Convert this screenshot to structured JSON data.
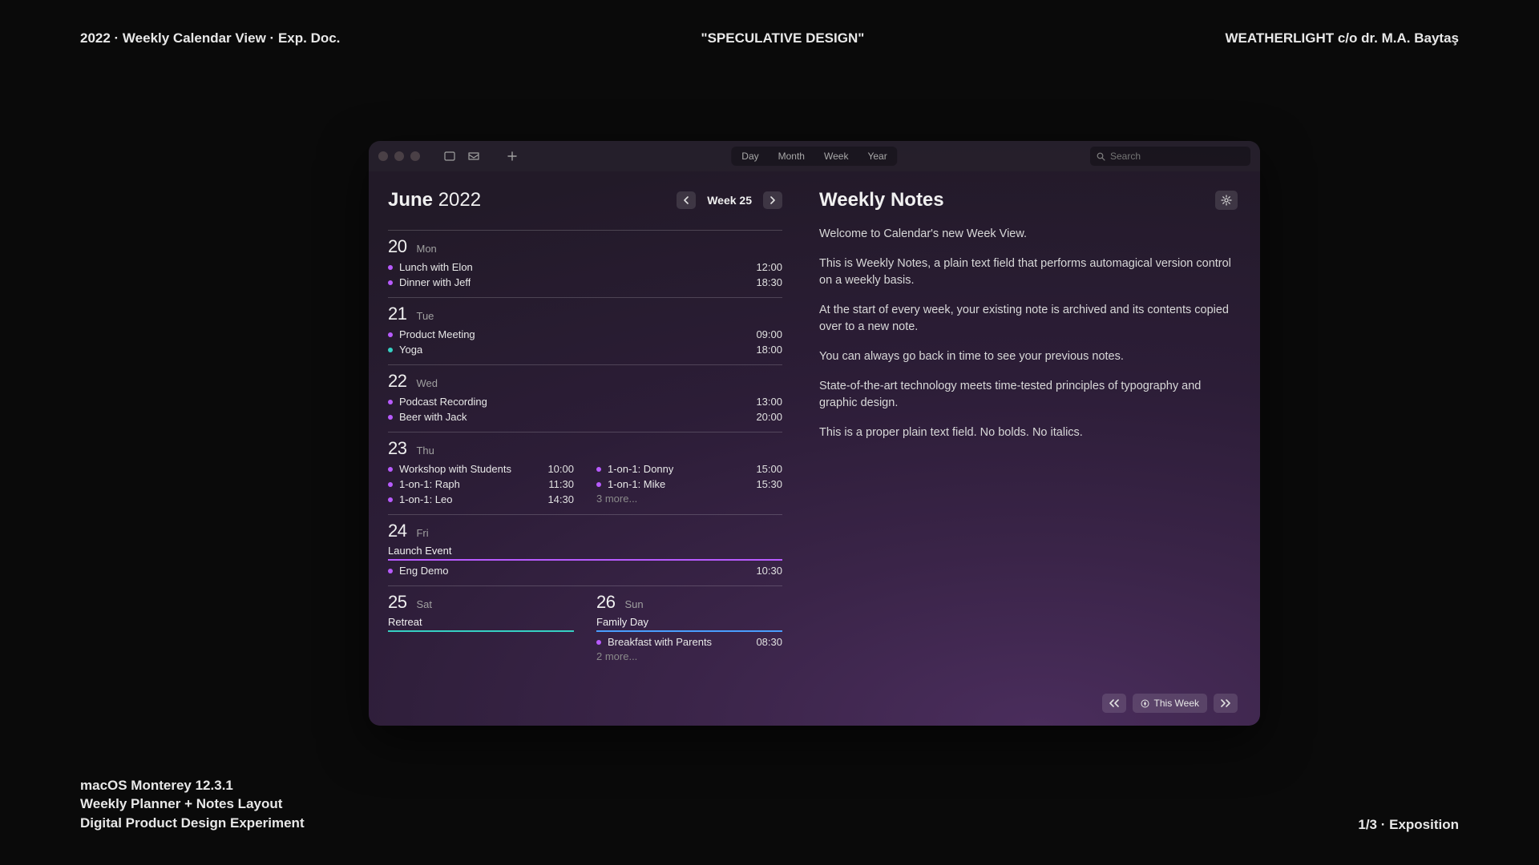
{
  "frame": {
    "header_left": "2022 · Weekly Calendar View · Exp. Doc.",
    "header_center": "\"SPECULATIVE DESIGN\"",
    "header_right": "WEATHERLIGHT c/o dr. M.A. Baytaş",
    "footer_left_1": "macOS Monterey 12.3.1",
    "footer_left_2": "Weekly Planner + Notes Layout",
    "footer_left_3": "Digital Product Design Experiment",
    "footer_right": "1/3 · Exposition"
  },
  "toolbar": {
    "view_tabs": [
      "Day",
      "Month",
      "Week",
      "Year"
    ],
    "search_placeholder": "Search"
  },
  "calendar": {
    "month_strong": "June",
    "year": "2022",
    "week_label": "Week 25",
    "colors": {
      "purple": "#b85bff",
      "teal": "#36d1c4",
      "blue": "#4a9eff"
    },
    "days": [
      {
        "num": "20",
        "dow": "Mon",
        "cols": [
          {
            "events": [
              {
                "title": "Lunch with Elon",
                "time": "12:00",
                "color": "purple"
              },
              {
                "title": "Dinner with Jeff",
                "time": "18:30",
                "color": "purple"
              }
            ]
          }
        ]
      },
      {
        "num": "21",
        "dow": "Tue",
        "cols": [
          {
            "events": [
              {
                "title": "Product Meeting",
                "time": "09:00",
                "color": "purple"
              },
              {
                "title": "Yoga",
                "time": "18:00",
                "color": "teal"
              }
            ]
          }
        ]
      },
      {
        "num": "22",
        "dow": "Wed",
        "cols": [
          {
            "events": [
              {
                "title": "Podcast Recording",
                "time": "13:00",
                "color": "purple"
              },
              {
                "title": "Beer with Jack",
                "time": "20:00",
                "color": "purple"
              }
            ]
          }
        ]
      },
      {
        "num": "23",
        "dow": "Thu",
        "cols": [
          {
            "events": [
              {
                "title": "Workshop with Students",
                "time": "10:00",
                "color": "purple"
              },
              {
                "title": "1-on-1: Raph",
                "time": "11:30",
                "color": "purple"
              },
              {
                "title": "1-on-1: Leo",
                "time": "14:30",
                "color": "purple"
              }
            ]
          },
          {
            "events": [
              {
                "title": "1-on-1: Donny",
                "time": "15:00",
                "color": "purple"
              },
              {
                "title": "1-on-1: Mike",
                "time": "15:30",
                "color": "purple"
              }
            ],
            "more": "3 more..."
          }
        ]
      },
      {
        "num": "24",
        "dow": "Fri",
        "cols": [
          {
            "allday": {
              "title": "Launch Event",
              "color": "purple"
            },
            "events": [
              {
                "title": "Eng Demo",
                "time": "10:30",
                "color": "purple"
              }
            ]
          }
        ]
      }
    ],
    "weekend": {
      "sat": {
        "num": "25",
        "dow": "Sat",
        "allday": {
          "title": "Retreat",
          "color": "teal"
        }
      },
      "sun": {
        "num": "26",
        "dow": "Sun",
        "allday": {
          "title": "Family Day",
          "color": "blue"
        },
        "events": [
          {
            "title": "Breakfast with Parents",
            "time": "08:30",
            "color": "purple"
          }
        ],
        "more": "2 more..."
      }
    }
  },
  "notes": {
    "title": "Weekly Notes",
    "paragraphs": [
      "Welcome to Calendar's new Week View.",
      "This is Weekly Notes, a plain text field that performs automagical version control on a weekly basis.",
      "At the start of every week, your existing note is archived and its contents copied over to a new note.",
      "You can always go back in time to see your previous notes.",
      "State-of-the-art technology meets time-tested principles of typography and graphic design.",
      "This is a proper plain text field. No bolds. No italics."
    ],
    "this_week_btn": "This Week"
  }
}
